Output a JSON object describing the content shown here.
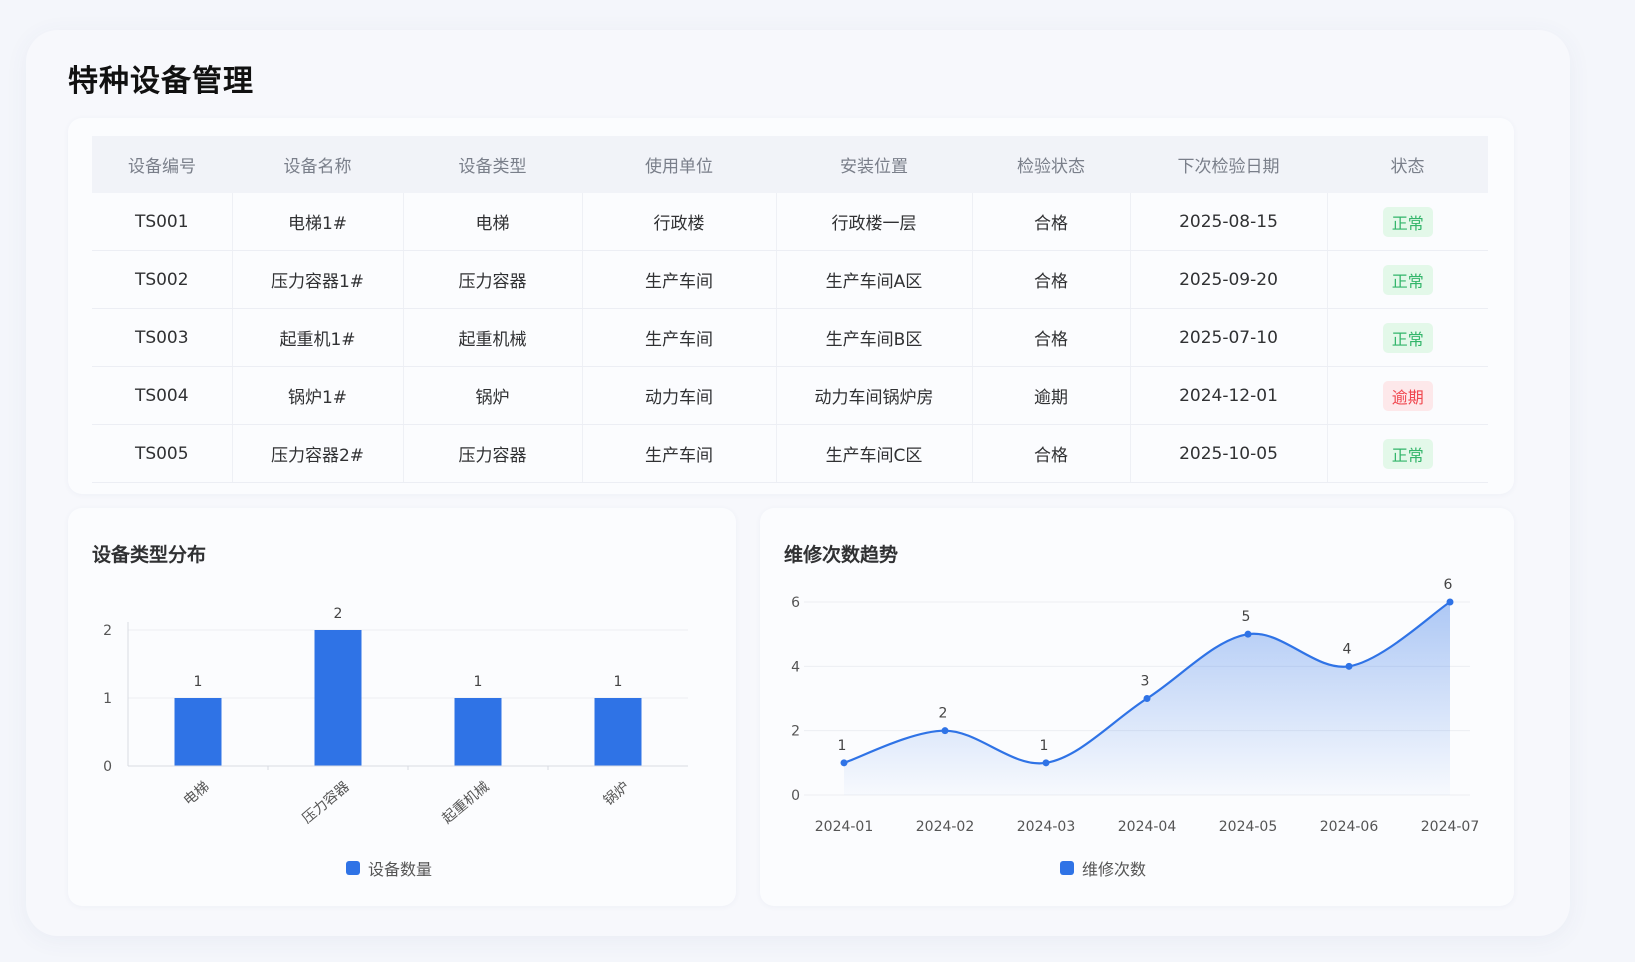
{
  "page": {
    "title": "特种设备管理"
  },
  "table": {
    "columns": [
      "设备编号",
      "设备名称",
      "设备类型",
      "使用单位",
      "安装位置",
      "检验状态",
      "下次检验日期",
      "状态"
    ],
    "rows": [
      {
        "id": "TS001",
        "name": "电梯1#",
        "type": "电梯",
        "unit": "行政楼",
        "location": "行政楼一层",
        "inspection": "合格",
        "next_date": "2025-08-15",
        "status": "正常",
        "status_kind": "ok"
      },
      {
        "id": "TS002",
        "name": "压力容器1#",
        "type": "压力容器",
        "unit": "生产车间",
        "location": "生产车间A区",
        "inspection": "合格",
        "next_date": "2025-09-20",
        "status": "正常",
        "status_kind": "ok"
      },
      {
        "id": "TS003",
        "name": "起重机1#",
        "type": "起重机械",
        "unit": "生产车间",
        "location": "生产车间B区",
        "inspection": "合格",
        "next_date": "2025-07-10",
        "status": "正常",
        "status_kind": "ok"
      },
      {
        "id": "TS004",
        "name": "锅炉1#",
        "type": "锅炉",
        "unit": "动力车间",
        "location": "动力车间锅炉房",
        "inspection": "逾期",
        "next_date": "2024-12-01",
        "status": "逾期",
        "status_kind": "bad"
      },
      {
        "id": "TS005",
        "name": "压力容器2#",
        "type": "压力容器",
        "unit": "生产车间",
        "location": "生产车间C区",
        "inspection": "合格",
        "next_date": "2025-10-05",
        "status": "正常",
        "status_kind": "ok"
      }
    ]
  },
  "colors": {
    "accent": "#2f73e6",
    "ok": "#33b56a",
    "bad": "#f0464e"
  },
  "chart_data": [
    {
      "type": "bar",
      "title": "设备类型分布",
      "categories": [
        "电梯",
        "压力容器",
        "起重机械",
        "锅炉"
      ],
      "series": [
        {
          "name": "设备数量",
          "values": [
            1,
            2,
            1,
            1
          ]
        }
      ],
      "ylim": [
        0,
        2
      ],
      "yticks": [
        0,
        1,
        2
      ],
      "grid": true,
      "legend": "bottom"
    },
    {
      "type": "area",
      "title": "维修次数趋势",
      "categories": [
        "2024-01",
        "2024-02",
        "2024-03",
        "2024-04",
        "2024-05",
        "2024-06",
        "2024-07"
      ],
      "series": [
        {
          "name": "维修次数",
          "values": [
            1,
            2,
            1,
            3,
            5,
            4,
            6
          ]
        }
      ],
      "ylim": [
        0,
        6
      ],
      "yticks": [
        0,
        2,
        4,
        6
      ],
      "smooth": true,
      "grid": true,
      "legend": "bottom"
    }
  ]
}
